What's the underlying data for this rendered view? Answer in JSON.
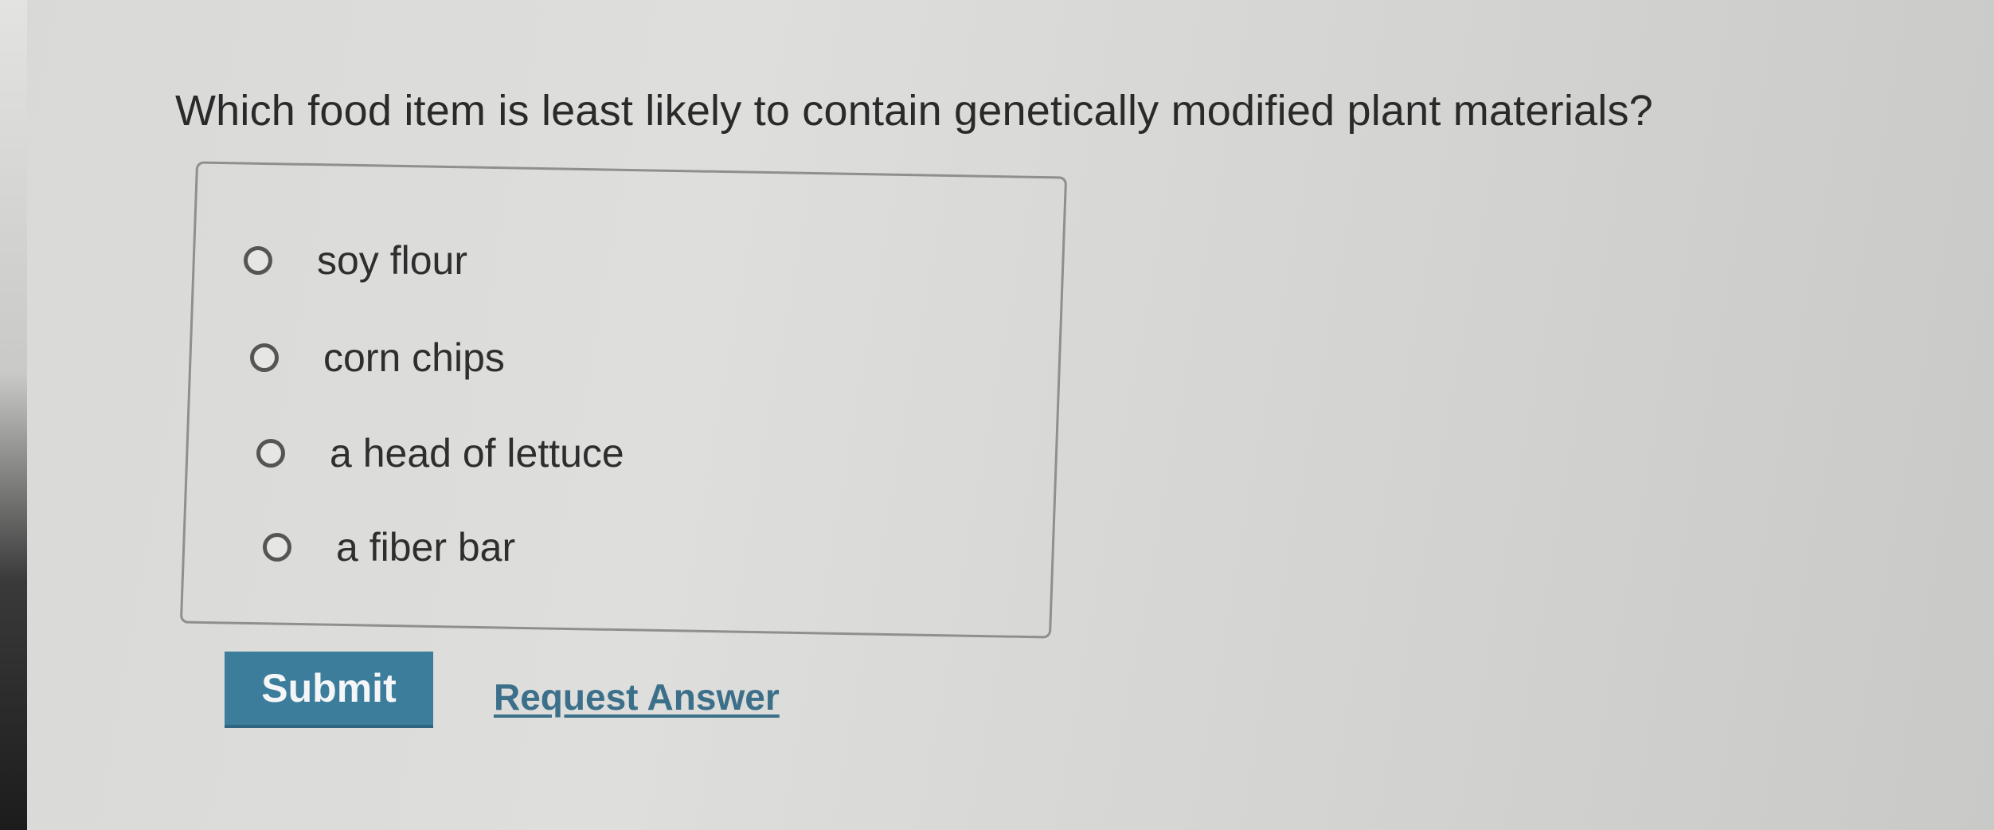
{
  "question": {
    "text": "Which food item is least likely to contain genetically modified plant materials?"
  },
  "options": [
    {
      "label": "soy flour",
      "selected": false
    },
    {
      "label": "corn chips",
      "selected": false
    },
    {
      "label": "a head of lettuce",
      "selected": false
    },
    {
      "label": "a fiber bar",
      "selected": false
    }
  ],
  "actions": {
    "submit_label": "Submit",
    "request_answer_label": "Request Answer"
  },
  "colors": {
    "submit_bg": "#3c7d9c",
    "link": "#3c6f89"
  }
}
